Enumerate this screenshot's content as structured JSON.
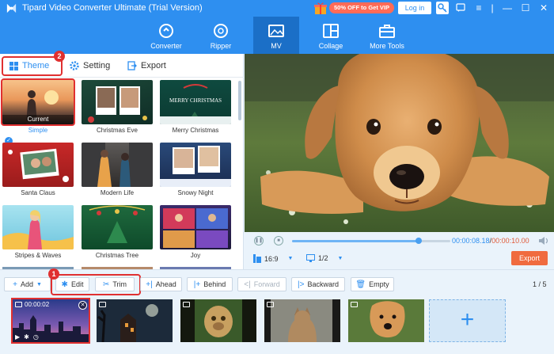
{
  "app": {
    "title": "Tipard Video Converter Ultimate (Trial Version)",
    "vip_text": "50% OFF to Get VIP",
    "login_label": "Log in",
    "brand_color": "#2e8ff0"
  },
  "modules": [
    {
      "label": "Converter",
      "icon": "converter-icon"
    },
    {
      "label": "Ripper",
      "icon": "ripper-icon"
    },
    {
      "label": "MV",
      "icon": "mv-icon",
      "active": true
    },
    {
      "label": "Collage",
      "icon": "collage-icon"
    },
    {
      "label": "More Tools",
      "icon": "toolbox-icon"
    }
  ],
  "tabs": [
    {
      "label": "Theme",
      "active": true
    },
    {
      "label": "Setting"
    },
    {
      "label": "Export"
    }
  ],
  "annotations": {
    "tabs_badge": "2",
    "tools_badge": "1"
  },
  "themes": [
    {
      "label": "Simple",
      "current_label": "Current",
      "selected": true
    },
    {
      "label": "Christmas Eve"
    },
    {
      "label": "Merry Christmas"
    },
    {
      "label": "Santa Claus"
    },
    {
      "label": "Modern Life"
    },
    {
      "label": "Snowy Night"
    },
    {
      "label": "Stripes & Waves"
    },
    {
      "label": "Christmas Tree"
    },
    {
      "label": "Joy"
    }
  ],
  "theme_overlay_text": {
    "merry_christmas": "MERRY CHRISTMAS"
  },
  "player": {
    "current_time": "00:00:08.18",
    "separator": "/",
    "total_time": "00:00:10.00",
    "progress": 0.8,
    "aspect_ratio": "16:9",
    "page_select": "1/2",
    "export_label": "Export",
    "export_color": "#f06b3f"
  },
  "toolbar": {
    "add": "Add",
    "edit": "Edit",
    "trim": "Trim",
    "ahead": "Ahead",
    "behind": "Behind",
    "forward": "Forward",
    "backward": "Backward",
    "empty": "Empty",
    "page_count": "1 / 5"
  },
  "timeline": {
    "clips": [
      {
        "name": "city-night",
        "time": "00:00:02",
        "selected": true
      },
      {
        "name": "haunted-house"
      },
      {
        "name": "monkey"
      },
      {
        "name": "cat"
      },
      {
        "name": "puppy"
      }
    ],
    "add_label": "+"
  }
}
